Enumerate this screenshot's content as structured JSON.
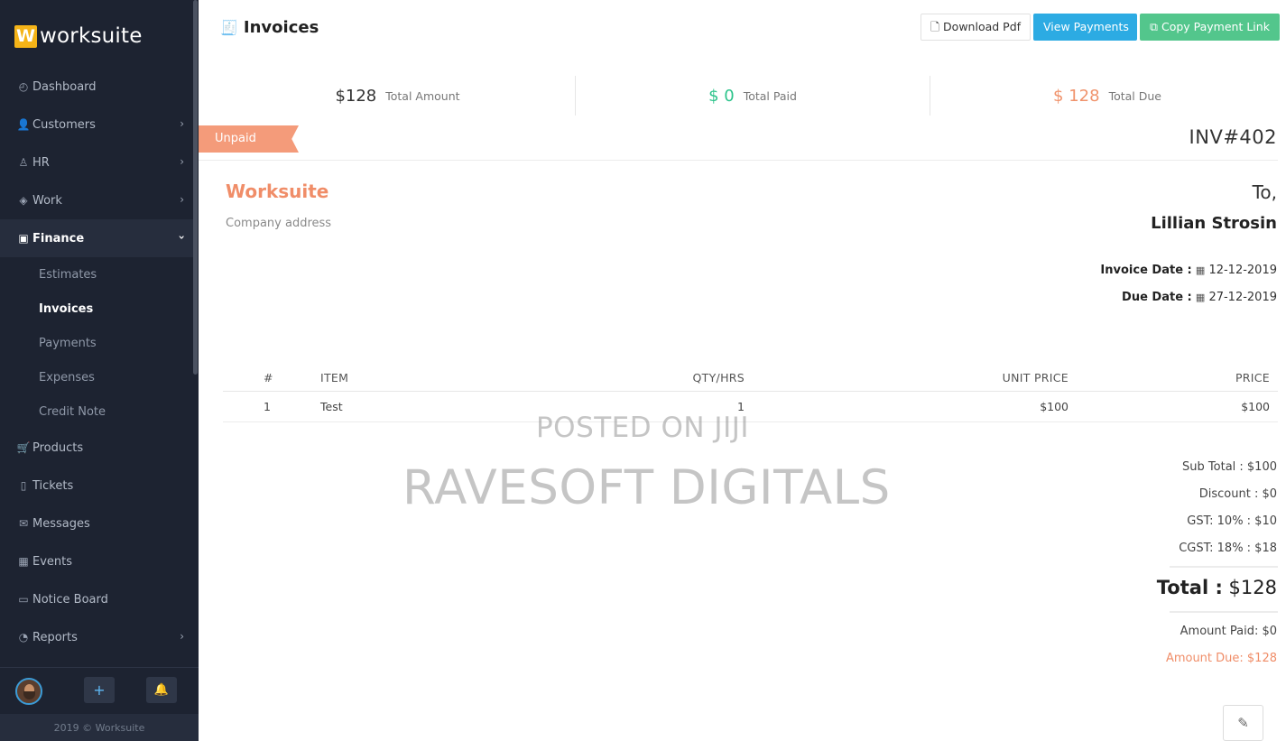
{
  "app": {
    "logo_letter": "W",
    "logo_text": "worksuite",
    "copyright": "2019 © Worksuite"
  },
  "sidebar": {
    "items": [
      {
        "label": "Dashboard",
        "icon": "dashboard-gauge-icon"
      },
      {
        "label": "Customers",
        "icon": "customers-icon",
        "has_children": true
      },
      {
        "label": "HR",
        "icon": "user-icon",
        "has_children": true
      },
      {
        "label": "Work",
        "icon": "layers-icon",
        "has_children": true
      },
      {
        "label": "Finance",
        "icon": "money-icon",
        "has_children": true,
        "expanded": true
      },
      {
        "label": "Products",
        "icon": "cart-icon"
      },
      {
        "label": "Tickets",
        "icon": "ticket-icon"
      },
      {
        "label": "Messages",
        "icon": "envelope-icon"
      },
      {
        "label": "Events",
        "icon": "calendar-icon"
      },
      {
        "label": "Notice Board",
        "icon": "notice-board-icon"
      },
      {
        "label": "Reports",
        "icon": "pie-chart-icon",
        "has_children": true
      }
    ],
    "finance_sub": [
      "Estimates",
      "Invoices",
      "Payments",
      "Expenses",
      "Credit Note"
    ],
    "current_sub": "Invoices"
  },
  "footer_buttons": {
    "add": "+",
    "notifications": "🔔"
  },
  "page": {
    "title": "Invoices",
    "title_icon": "receipt-icon"
  },
  "toolbar": {
    "download_pdf": "Download Pdf",
    "view_payments": "View Payments",
    "copy_payment_link": "Copy Payment Link"
  },
  "stats": [
    {
      "value": "$128",
      "label": "Total Amount",
      "color": "#333333"
    },
    {
      "value": "$ 0",
      "label": "Total Paid",
      "color": "#2ec48c"
    },
    {
      "value": "$ 128",
      "label": "Total Due",
      "color": "#f0936c"
    }
  ],
  "invoice": {
    "status": "Unpaid",
    "number": "INV#402",
    "company": "Worksuite",
    "company_address": "Company address",
    "to_label": "To,",
    "client": "Lillian Strosin",
    "invoice_date_label": "Invoice Date :",
    "invoice_date": "12-12-2019",
    "due_date_label": "Due Date :",
    "due_date": "27-12-2019"
  },
  "table": {
    "headers": [
      "#",
      "ITEM",
      "QTY/HRS",
      "UNIT PRICE",
      "PRICE"
    ],
    "rows": [
      {
        "num": "1",
        "item": "Test",
        "qty": "1",
        "unit_price": "$100",
        "price": "$100"
      }
    ]
  },
  "totals": {
    "sub_total": "Sub Total : $100",
    "discount": "Discount : $0",
    "gst": "GST: 10% : $10",
    "cgst": "CGST: 18% : $18",
    "total_label": "Total :",
    "total_value": "$128",
    "amount_paid": "Amount Paid: $0",
    "amount_due": "Amount Due: $128"
  },
  "watermark": {
    "line1": "POSTED ON JIJI",
    "line2": "RAVESOFT DIGITALS"
  },
  "colors": {
    "sidebar_bg": "#1d2331",
    "accent_orange": "#f08d68",
    "blue": "#2cabe3",
    "green": "#53c68c",
    "logo_yellow": "#f5b418"
  }
}
